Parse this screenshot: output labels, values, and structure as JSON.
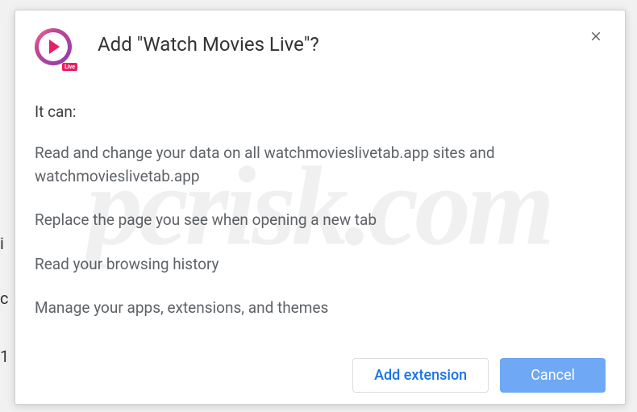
{
  "dialog": {
    "title": "Add \"Watch Movies Live\"?",
    "extension_name": "Watch Movies Live",
    "live_badge": "Live",
    "permissions_intro": "It can:",
    "permissions": [
      "Read and change your data on all watchmovieslivetab.app sites and watchmovieslivetab.app",
      "Replace the page you see when opening a new tab",
      "Read your browsing history",
      "Manage your apps, extensions, and themes"
    ],
    "buttons": {
      "add": "Add extension",
      "cancel": "Cancel"
    }
  },
  "watermark": "pcrisk.com",
  "side_chars": {
    "c1": "i",
    "c2": "c",
    "c3": "1"
  }
}
